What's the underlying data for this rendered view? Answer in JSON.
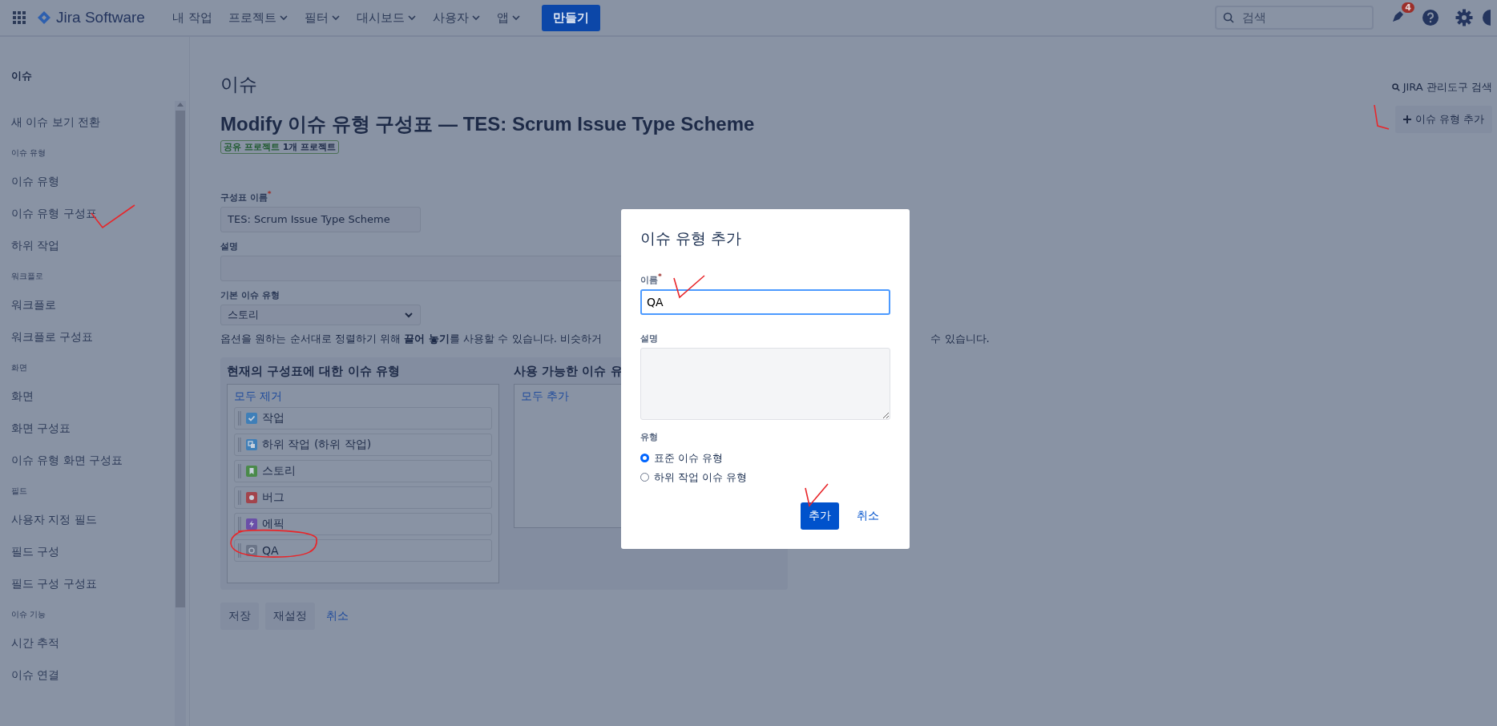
{
  "topbar": {
    "product": "Jira Software",
    "nav": [
      {
        "label": "내 작업",
        "dropdown": false
      },
      {
        "label": "프로젝트",
        "dropdown": true
      },
      {
        "label": "필터",
        "dropdown": true
      },
      {
        "label": "대시보드",
        "dropdown": true
      },
      {
        "label": "사용자",
        "dropdown": true
      },
      {
        "label": "앱",
        "dropdown": true
      }
    ],
    "create_button": "만들기",
    "search": {
      "placeholder": "검색"
    },
    "notification_count": "4"
  },
  "sidebar": {
    "title": "이슈",
    "sections": [
      {
        "items": [
          "새 이슈 보기 전환"
        ]
      },
      {
        "header": "이슈 유형",
        "items": [
          "이슈 유형",
          "이슈 유형 구성표",
          "하위 작업"
        ]
      },
      {
        "header": "워크플로",
        "items": [
          "워크플로",
          "워크플로 구성표"
        ]
      },
      {
        "header": "화면",
        "items": [
          "화면",
          "화면 구성표",
          "이슈 유형 화면 구성표"
        ]
      },
      {
        "header": "필드",
        "items": [
          "사용자 지정 필드",
          "필드 구성",
          "필드 구성 구성표"
        ]
      },
      {
        "header": "이슈 기능",
        "items": [
          "시간 추적",
          "이슈 연결"
        ]
      }
    ]
  },
  "page": {
    "section_title": "이슈",
    "heading": "Modify 이슈 유형 구성표 — TES: Scrum Issue Type Scheme",
    "badge": {
      "label": "공유 프로젝트",
      "count": "1개 프로젝트"
    },
    "admin_search": "JIRA 관리도구 검색",
    "add_issue_type_button": "이슈 유형 추가",
    "form": {
      "scheme_name": {
        "label": "구성표 이름",
        "required_mark": "*",
        "value": "TES: Scrum Issue Type Scheme"
      },
      "description": {
        "label": "설명"
      },
      "default_type": {
        "label": "기본 이슈 유형",
        "value": "스토리"
      },
      "hint_before": "옵션을 원하는 순서대로 정렬하기 위해 **끌어 놓기**를 사용할 수 있습니다. 비슷하거",
      "hint_after": "수 있습니다."
    },
    "current_types": {
      "heading": "현재의 구성표에 대한 이슈 유형",
      "remove_all": "모두 제거",
      "items": [
        {
          "label": "작업",
          "kind": "task",
          "color": "#3f7fb8"
        },
        {
          "label": "하위 작업 (하위 작업)",
          "kind": "subtask",
          "color": "#3f7fb8"
        },
        {
          "label": "스토리",
          "kind": "story",
          "color": "#4a8a4a"
        },
        {
          "label": "버그",
          "kind": "bug",
          "color": "#a2444c"
        },
        {
          "label": "에픽",
          "kind": "epic",
          "color": "#6a4fa8"
        },
        {
          "label": "QA",
          "kind": "generic",
          "color": "#6b7588"
        }
      ]
    },
    "available_types": {
      "heading": "사용 가능한 이슈 유",
      "add_all": "모두 추가"
    },
    "buttons": [
      {
        "label": "저장",
        "kind": "button"
      },
      {
        "label": "재설정",
        "kind": "button"
      },
      {
        "label": "취소",
        "kind": "link"
      }
    ]
  },
  "dialog": {
    "title": "이슈 유형 추가",
    "name": {
      "label": "이름",
      "required_mark": "*",
      "value": "QA"
    },
    "description": {
      "label": "설명"
    },
    "type": {
      "label": "유형",
      "options": [
        {
          "label": "표준 이슈 유형",
          "selected": true
        },
        {
          "label": "하위 작업 이슈 유형",
          "selected": false
        }
      ]
    },
    "add_button": "추가",
    "cancel_link": "취소"
  }
}
